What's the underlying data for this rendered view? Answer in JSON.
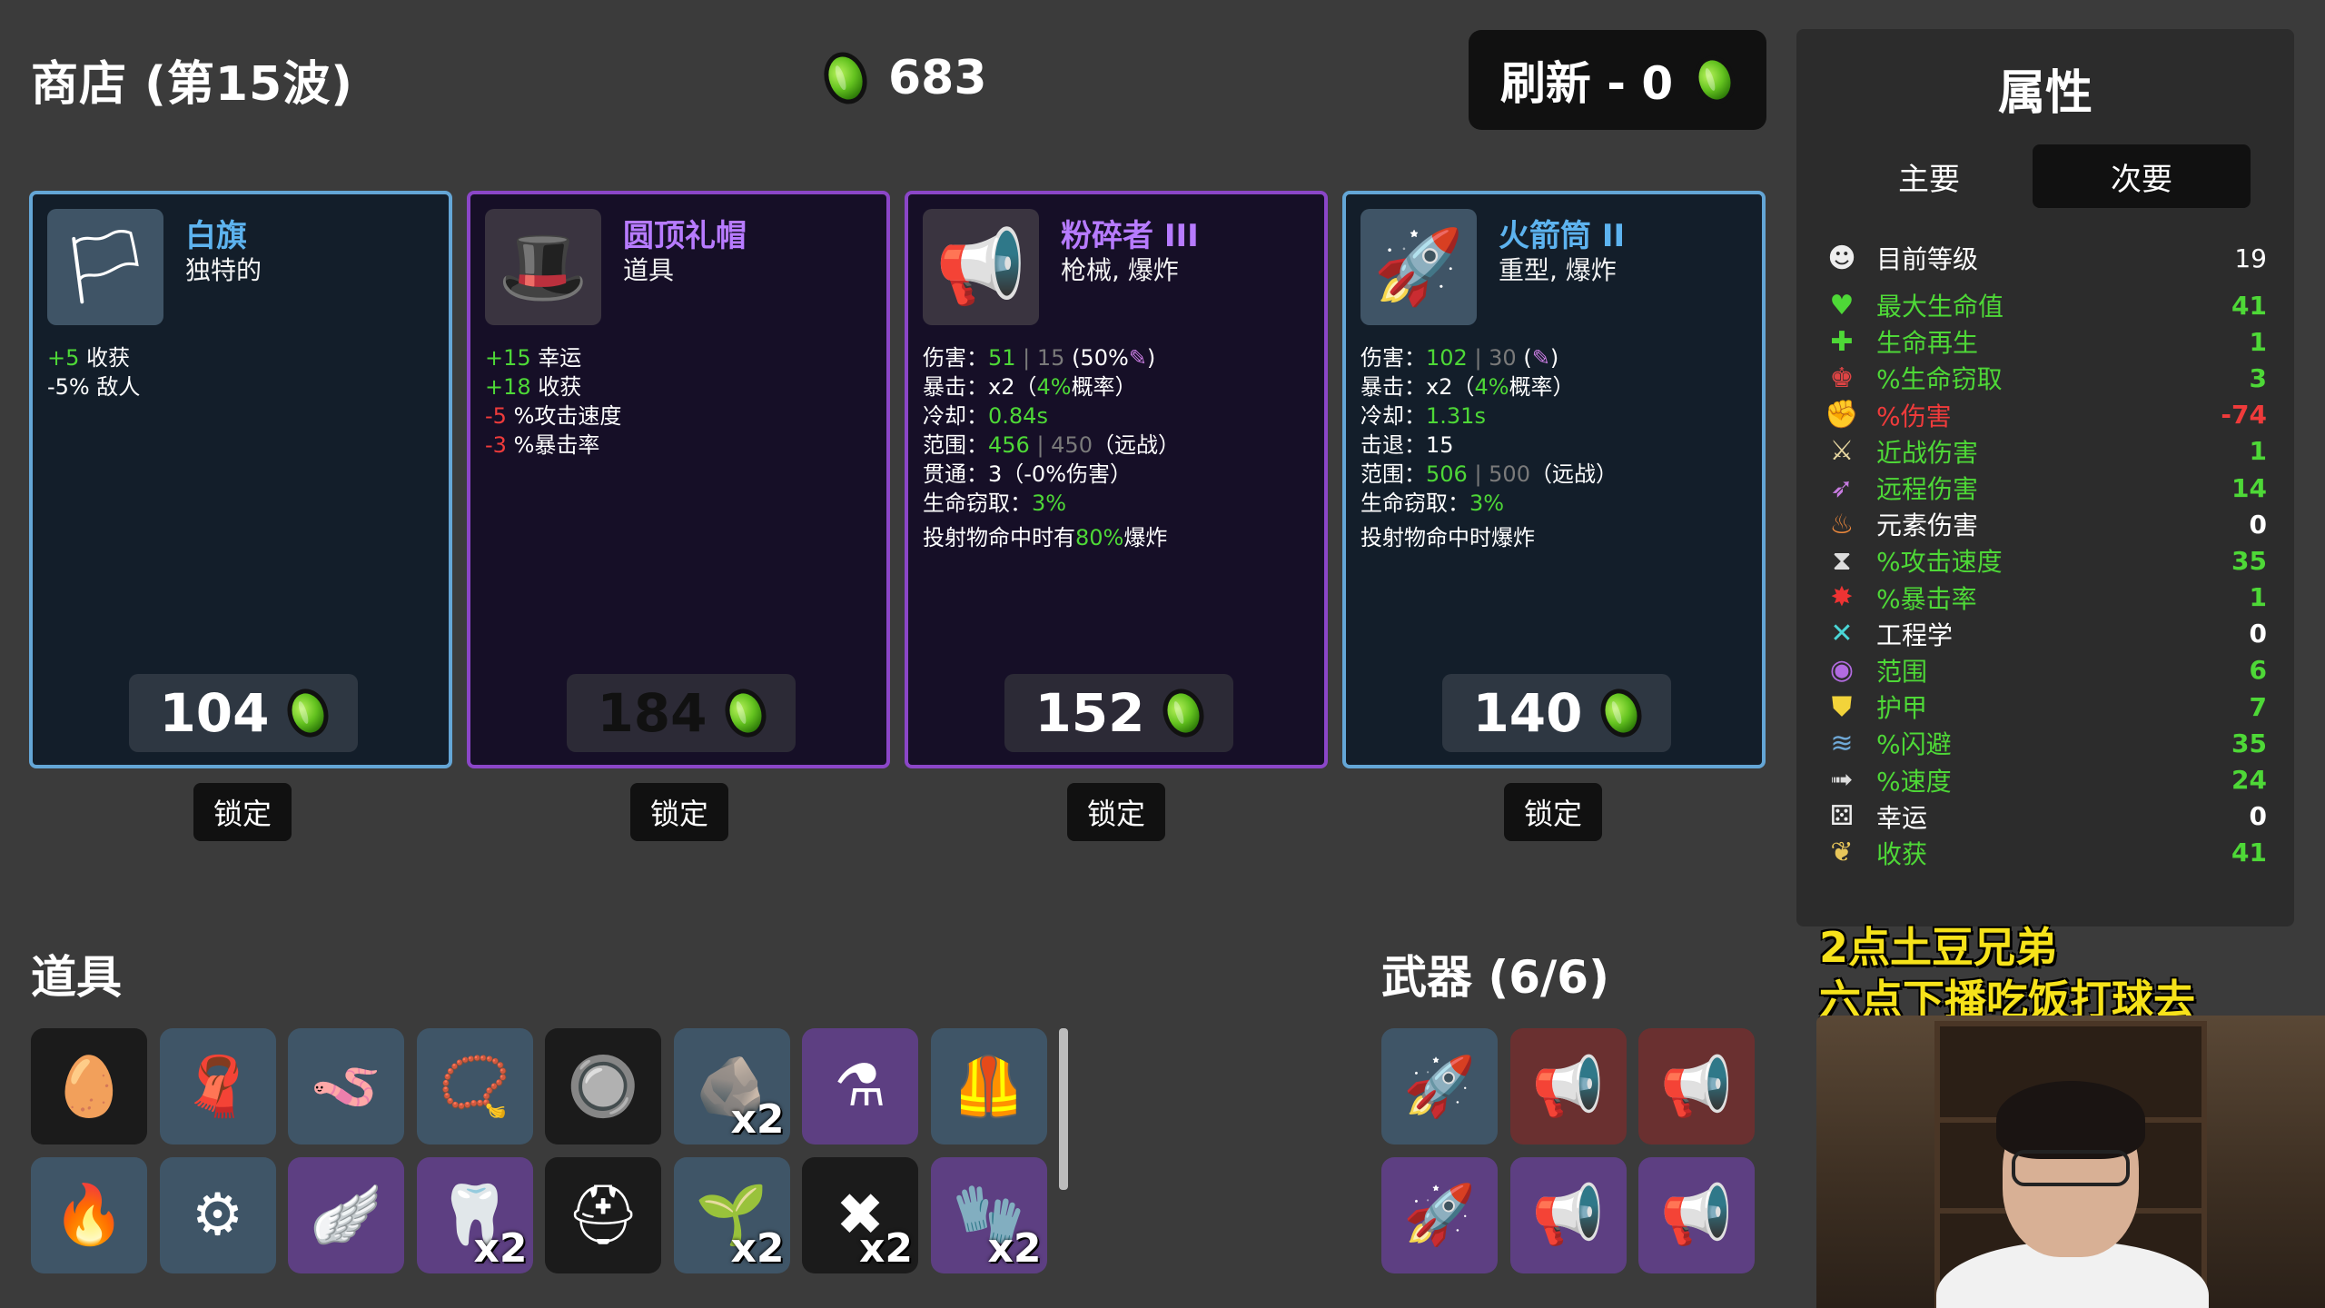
{
  "header": {
    "title": "商店 (第15波)",
    "coins": "683",
    "reroll_label": "刷新 - 0"
  },
  "shop_cards": [
    {
      "name": "白旗",
      "type": "独特的",
      "icon": "white-flag-icon",
      "price": "104",
      "lock_label": "锁定",
      "stat_lines": [
        [
          {
            "t": "+5",
            "c": "g"
          },
          {
            "t": " 收获"
          }
        ],
        [
          {
            "t": "-5% 敌人"
          }
        ]
      ]
    },
    {
      "name": "圆顶礼帽",
      "type": "道具",
      "icon": "bowler-hat-icon",
      "price": "184",
      "lock_label": "锁定",
      "stat_lines": [
        [
          {
            "t": "+15",
            "c": "g"
          },
          {
            "t": " 幸运"
          }
        ],
        [
          {
            "t": "+18",
            "c": "g"
          },
          {
            "t": " 收获"
          }
        ],
        [
          {
            "t": "-5",
            "c": "r"
          },
          {
            "t": " %攻击速度"
          }
        ],
        [
          {
            "t": "-3",
            "c": "r"
          },
          {
            "t": " %暴击率"
          }
        ]
      ]
    },
    {
      "name": "粉碎者 III",
      "type": "枪械, 爆炸",
      "icon": "megaphone-gun-icon",
      "price": "152",
      "lock_label": "锁定",
      "stat_lines": [
        [
          {
            "t": "伤害："
          },
          {
            "t": "51",
            "c": "g"
          },
          {
            "t": " | 15",
            "c": "dim"
          },
          {
            "t": " (50%"
          },
          {
            "t": "✎",
            "c": "p"
          },
          {
            "t": ")"
          }
        ],
        [
          {
            "t": "暴击：x2（"
          },
          {
            "t": "4%",
            "c": "g"
          },
          {
            "t": "概率）"
          }
        ],
        [
          {
            "t": "冷却："
          },
          {
            "t": "0.84s",
            "c": "g"
          }
        ],
        [
          {
            "t": "范围："
          },
          {
            "t": "456",
            "c": "g"
          },
          {
            "t": " | 450",
            "c": "dim"
          },
          {
            "t": "（远战）"
          }
        ],
        [
          {
            "t": "贯通：3（-0%伤害）"
          }
        ],
        [
          {
            "t": "生命窃取："
          },
          {
            "t": "3%",
            "c": "g"
          }
        ],
        [
          {
            "t": "投射物命中时有"
          },
          {
            "t": "80%",
            "c": "g"
          },
          {
            "t": "爆炸"
          }
        ]
      ]
    },
    {
      "name": "火箭筒 II",
      "type": "重型, 爆炸",
      "icon": "rocket-launcher-icon",
      "price": "140",
      "lock_label": "锁定",
      "stat_lines": [
        [
          {
            "t": "伤害："
          },
          {
            "t": "102",
            "c": "g"
          },
          {
            "t": " | 30",
            "c": "dim"
          },
          {
            "t": " ("
          },
          {
            "t": "✎",
            "c": "p"
          },
          {
            "t": ")"
          }
        ],
        [
          {
            "t": "暴击：x2（"
          },
          {
            "t": "4%",
            "c": "g"
          },
          {
            "t": "概率）"
          }
        ],
        [
          {
            "t": "冷却："
          },
          {
            "t": "1.31s",
            "c": "g"
          }
        ],
        [
          {
            "t": "击退：15"
          }
        ],
        [
          {
            "t": "范围："
          },
          {
            "t": "506",
            "c": "g"
          },
          {
            "t": " | 500",
            "c": "dim"
          },
          {
            "t": "（远战）"
          }
        ],
        [
          {
            "t": "生命窃取："
          },
          {
            "t": "3%",
            "c": "g"
          }
        ],
        [
          {
            "t": "投射物命中时爆炸"
          }
        ]
      ]
    }
  ],
  "items_section": {
    "title": "道具",
    "slots": [
      {
        "icon": "egg-mask-icon",
        "glyph": "🥚",
        "tier": "n",
        "qty": ""
      },
      {
        "icon": "scarf-icon",
        "glyph": "🧣",
        "tier": "b",
        "qty": ""
      },
      {
        "icon": "worm-icon",
        "glyph": "🪱",
        "tier": "b",
        "qty": ""
      },
      {
        "icon": "amulet-icon",
        "glyph": "📿",
        "tier": "b",
        "qty": ""
      },
      {
        "icon": "buttons-icon",
        "glyph": "🔘",
        "tier": "n",
        "qty": ""
      },
      {
        "icon": "stone-icon",
        "glyph": "🪨",
        "tier": "b",
        "qty": "x2"
      },
      {
        "icon": "alchemy-icon",
        "glyph": "⚗",
        "tier": "p",
        "qty": ""
      },
      {
        "icon": "armor-vest-icon",
        "glyph": "🦺",
        "tier": "b",
        "qty": ""
      },
      {
        "icon": "campfire-icon",
        "glyph": "🔥",
        "tier": "b",
        "qty": ""
      },
      {
        "icon": "machine-icon",
        "glyph": "⚙",
        "tier": "b",
        "qty": ""
      },
      {
        "icon": "wings-icon",
        "glyph": "🪽",
        "tier": "p",
        "qty": ""
      },
      {
        "icon": "shark-tooth-icon",
        "glyph": "🦷",
        "tier": "p",
        "qty": "x2"
      },
      {
        "icon": "helmet-icon",
        "glyph": "⛑",
        "tier": "n",
        "qty": ""
      },
      {
        "icon": "plant-icon",
        "glyph": "🌱",
        "tier": "b",
        "qty": "x2"
      },
      {
        "icon": "scar-icon",
        "glyph": "✖",
        "tier": "n",
        "qty": "x2"
      },
      {
        "icon": "gauntlet-icon",
        "glyph": "🧤",
        "tier": "p",
        "qty": "x2"
      }
    ]
  },
  "weapons_section": {
    "title": "武器 (6/6)",
    "slots": [
      {
        "icon": "rocket-launcher-icon",
        "glyph": "🚀",
        "tier": "b"
      },
      {
        "icon": "megaphone-gun-icon",
        "glyph": "📢",
        "tier": "rd"
      },
      {
        "icon": "megaphone-gun-icon",
        "glyph": "📢",
        "tier": "rd"
      },
      {
        "icon": "rocket-launcher-icon",
        "glyph": "🚀",
        "tier": "p"
      },
      {
        "icon": "megaphone-gun-icon",
        "glyph": "📢",
        "tier": "p"
      },
      {
        "icon": "megaphone-gun-icon",
        "glyph": "📢",
        "tier": "p"
      }
    ]
  },
  "attributes": {
    "title": "属性",
    "tab_primary": "主要",
    "tab_secondary": "次要",
    "level_label": "目前等级",
    "level_value": "19",
    "stats": [
      {
        "label": "最大生命值",
        "value": "41",
        "color": "#4ed837",
        "icon": "heart-icon",
        "glyph": "♥",
        "icolor": "#4ed837"
      },
      {
        "label": "生命再生",
        "value": "1",
        "color": "#4ed837",
        "icon": "regen-icon",
        "glyph": "✚",
        "icolor": "#4ed837"
      },
      {
        "label": "%生命窃取",
        "value": "3",
        "color": "#4ed837",
        "icon": "lifesteal-icon",
        "glyph": "♚",
        "icolor": "#d44"
      },
      {
        "label": "%伤害",
        "value": "-74",
        "color": "#ef3b3b",
        "icon": "damage-icon",
        "glyph": "✊",
        "icolor": "#e55"
      },
      {
        "label": "近战伤害",
        "value": "1",
        "color": "#4ed837",
        "icon": "sword-icon",
        "glyph": "⚔",
        "icolor": "#e8d7a0"
      },
      {
        "label": "远程伤害",
        "value": "14",
        "color": "#4ed837",
        "icon": "bow-icon",
        "glyph": "➶",
        "icolor": "#c77be0"
      },
      {
        "label": "元素伤害",
        "value": "0",
        "color": "#ffffff",
        "icon": "flame-icon",
        "glyph": "♨",
        "icolor": "#f08a3c"
      },
      {
        "label": "%攻击速度",
        "value": "35",
        "color": "#4ed837",
        "icon": "hourglass-icon",
        "glyph": "⧗",
        "icolor": "#ddd"
      },
      {
        "label": "%暴击率",
        "value": "1",
        "color": "#4ed837",
        "icon": "crit-icon",
        "glyph": "✸",
        "icolor": "#e33"
      },
      {
        "label": "工程学",
        "value": "0",
        "color": "#ffffff",
        "icon": "wrench-icon",
        "glyph": "✕",
        "icolor": "#4ad6d6"
      },
      {
        "label": "范围",
        "value": "6",
        "color": "#4ed837",
        "icon": "range-icon",
        "glyph": "◉",
        "icolor": "#b26be0"
      },
      {
        "label": "护甲",
        "value": "7",
        "color": "#4ed837",
        "icon": "shield-icon",
        "glyph": "⛊",
        "icolor": "#f2d33a"
      },
      {
        "label": "%闪避",
        "value": "35",
        "color": "#4ed837",
        "icon": "dodge-icon",
        "glyph": "≋",
        "icolor": "#6fa8d6"
      },
      {
        "label": "%速度",
        "value": "24",
        "color": "#4ed837",
        "icon": "boot-icon",
        "glyph": "➟",
        "icolor": "#ddd"
      },
      {
        "label": "幸运",
        "value": "0",
        "color": "#ffffff",
        "icon": "dice-icon",
        "glyph": "⚄",
        "icolor": "#eee"
      },
      {
        "label": "收获",
        "value": "41",
        "color": "#4ed837",
        "icon": "wheat-icon",
        "glyph": "❦",
        "icolor": "#e8c65a"
      }
    ]
  },
  "stream_overlay": {
    "line1": "2点土豆兄弟",
    "line2": "六点下播吃饭打球去"
  }
}
